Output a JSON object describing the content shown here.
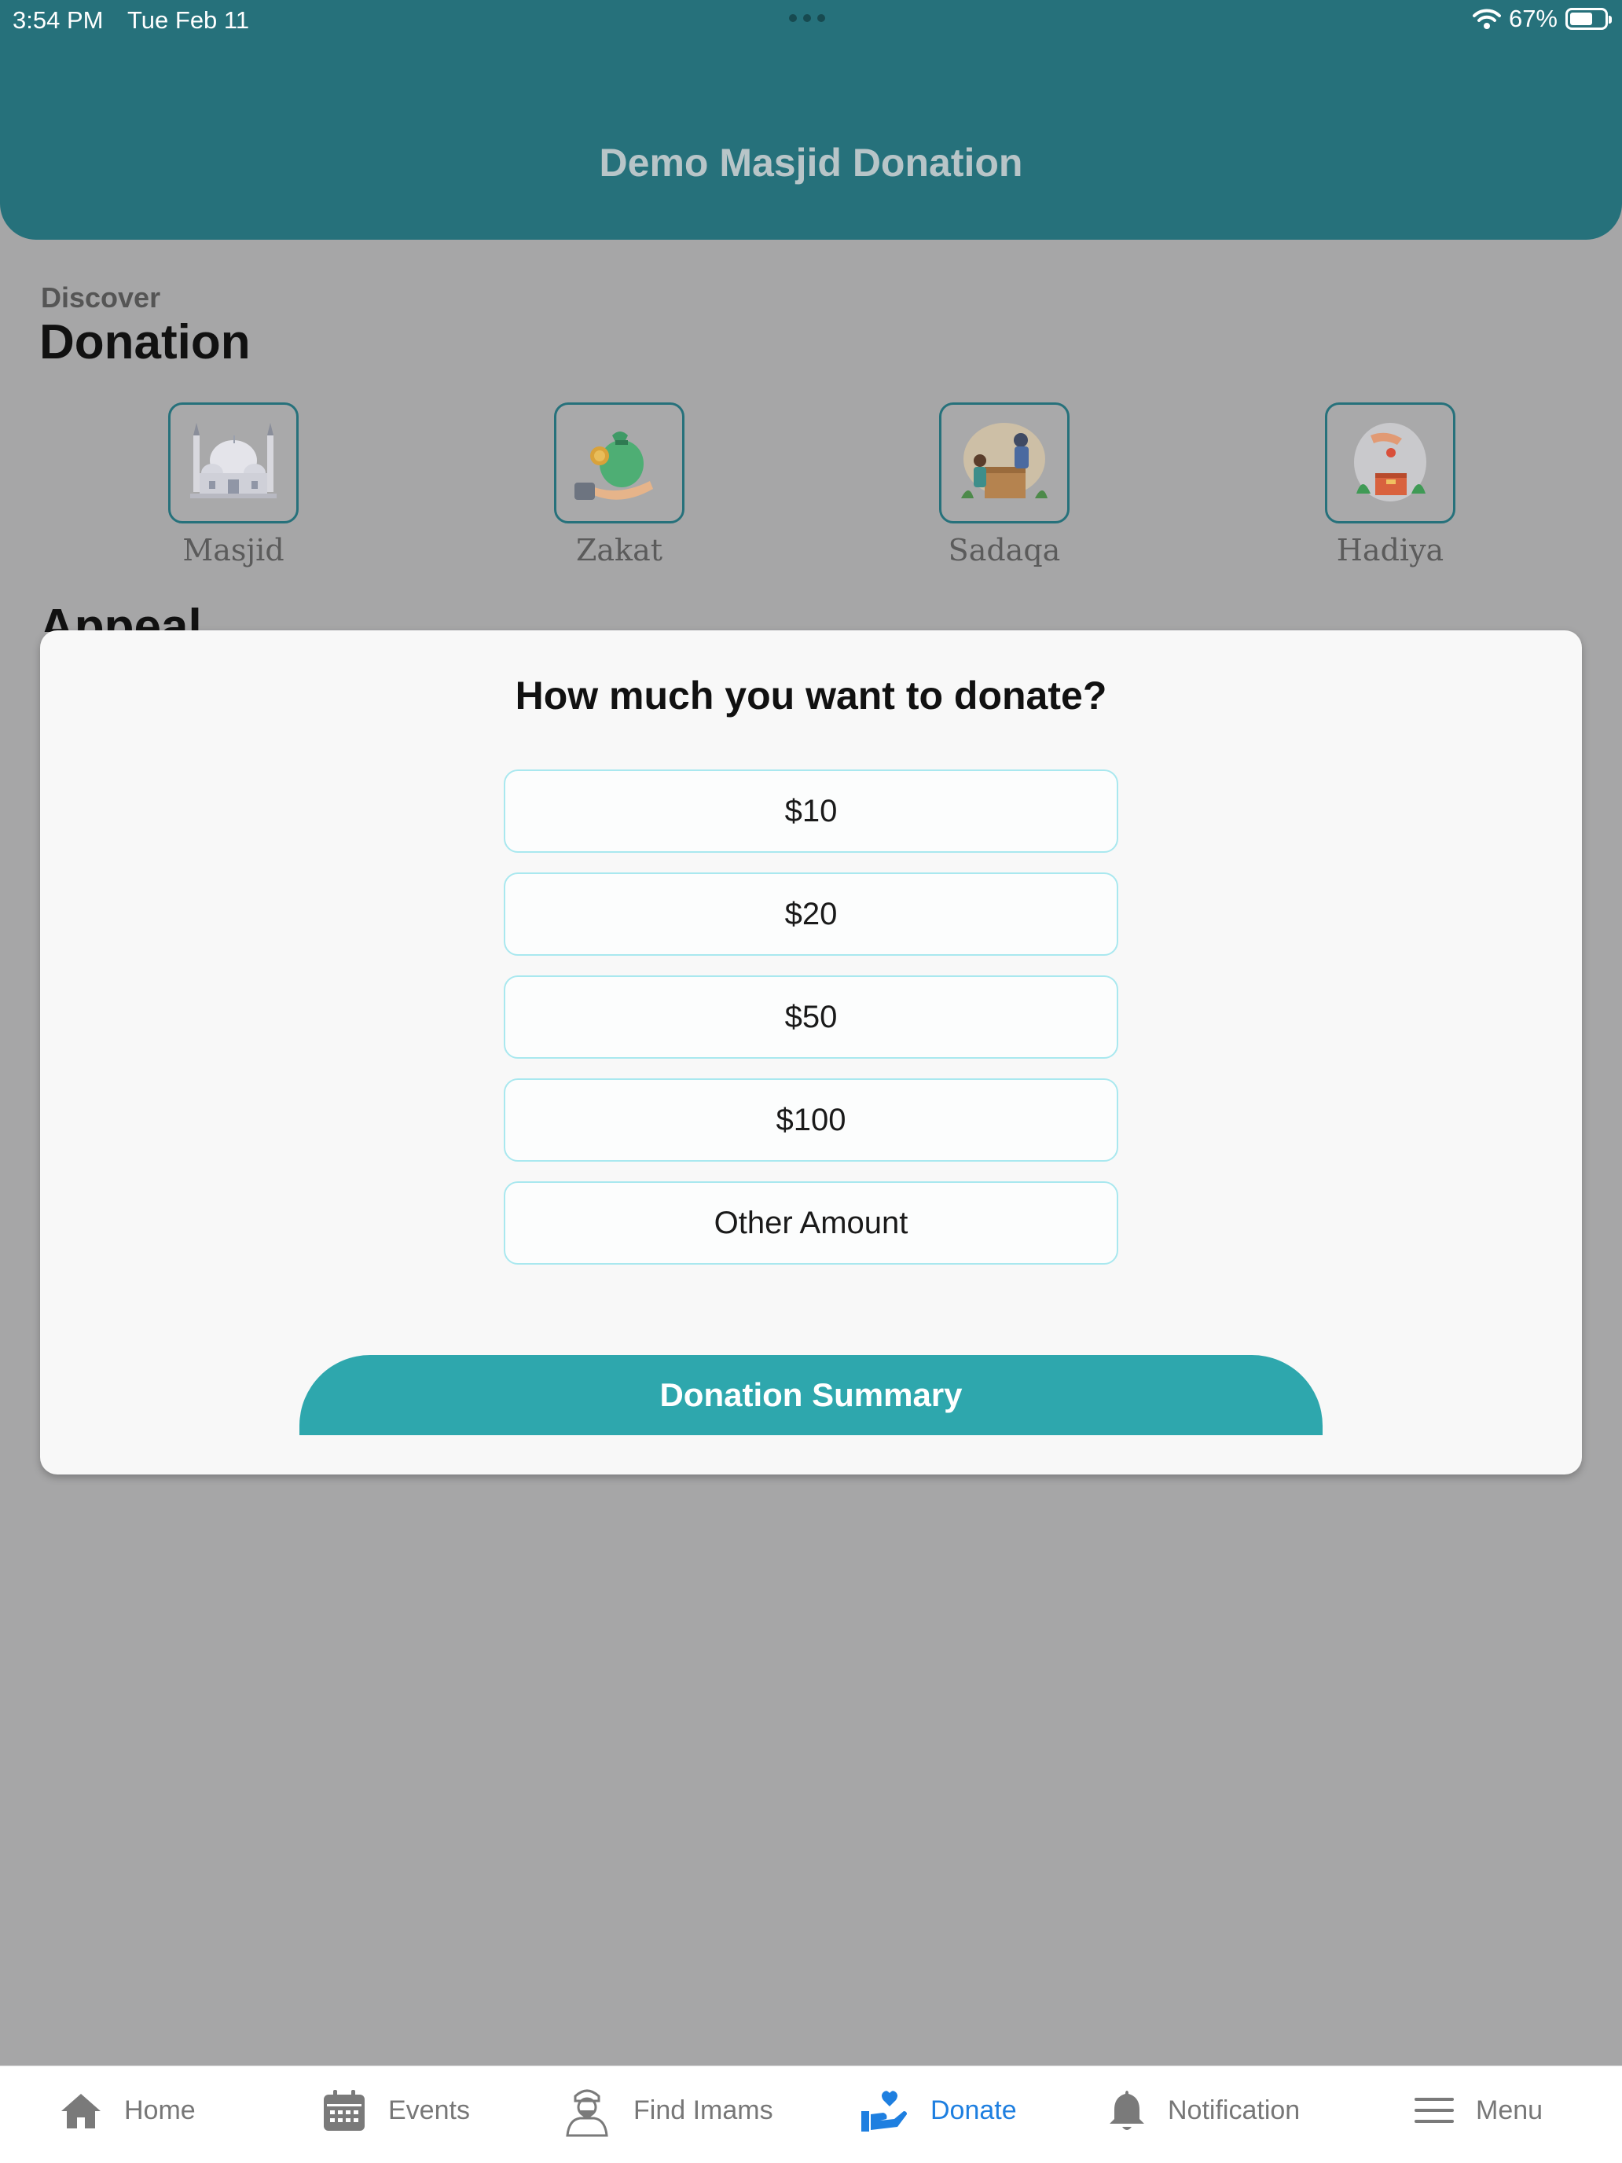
{
  "status_bar": {
    "time": "3:54 PM",
    "date": "Tue Feb 11",
    "battery": "67%"
  },
  "header": {
    "title": "Demo Masjid Donation"
  },
  "discover": {
    "label": "Discover",
    "title": "Donation",
    "categories": [
      {
        "label": "Masjid",
        "icon": "mosque-icon"
      },
      {
        "label": "Zakat",
        "icon": "money-bag-hand-icon"
      },
      {
        "label": "Sadaqa",
        "icon": "charity-box-people-icon"
      },
      {
        "label": "Hadiya",
        "icon": "gift-hands-box-icon"
      }
    ]
  },
  "appeal": {
    "title": "Appeal"
  },
  "modal": {
    "question": "How much you want to donate?",
    "amounts": [
      "$10",
      "$20",
      "$50",
      "$100"
    ],
    "other_amount": "Other Amount",
    "summary_button": "Donation Summary"
  },
  "tabbar": {
    "items": [
      {
        "label": "Home",
        "icon": "home-icon"
      },
      {
        "label": "Events",
        "icon": "calendar-icon"
      },
      {
        "label": "Find Imams",
        "icon": "imam-icon"
      },
      {
        "label": "Donate",
        "icon": "donate-hand-heart-icon",
        "active": true
      },
      {
        "label": "Notification",
        "icon": "bell-icon"
      },
      {
        "label": "Menu",
        "icon": "hamburger-menu-icon"
      }
    ]
  },
  "colors": {
    "header": "#26717b",
    "overlay": "#a6a6a7",
    "accent": "#2ea7ad",
    "active_tab": "#1e7fe0",
    "amount_border": "#a9e8ef"
  }
}
